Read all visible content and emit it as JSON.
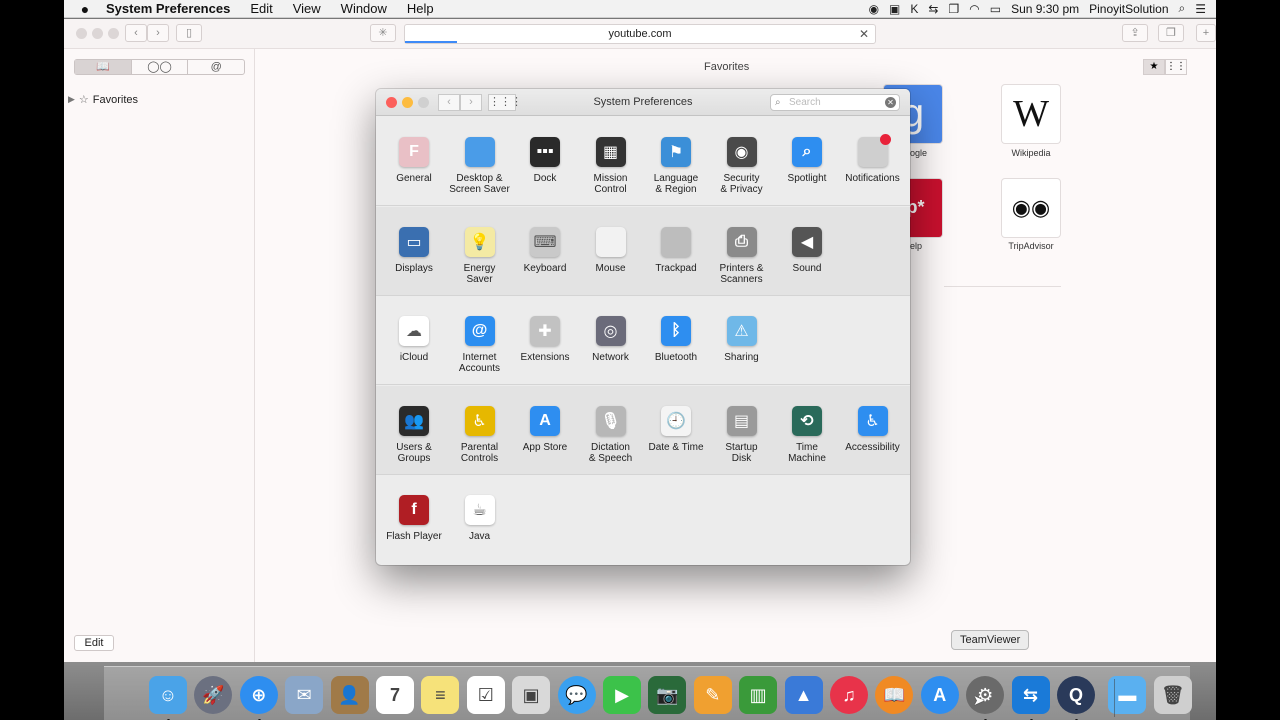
{
  "menubar": {
    "app_name": "System Preferences",
    "menus": [
      "Edit",
      "View",
      "Window",
      "Help"
    ],
    "clock": "Sun 9:30 pm",
    "user": "PinoyitSolution"
  },
  "safari": {
    "url": "youtube.com",
    "load_progress": 0.11,
    "sidebar_section": "Favorites",
    "edit_label": "Edit",
    "content_title": "Favorites",
    "favorites": [
      {
        "label": "oogle",
        "tile_text": "g",
        "color": "#4a86e8"
      },
      {
        "label": "Wikipedia",
        "tile_text": "W",
        "color": "#ffffff"
      },
      {
        "label": "elp",
        "tile_text": "ip*",
        "color": "#c8102e"
      },
      {
        "label": "TripAdvisor",
        "tile_text": "◉◉",
        "color": "#ffffff"
      }
    ]
  },
  "syspref": {
    "title": "System Preferences",
    "search_placeholder": "Search",
    "rows": [
      [
        {
          "label": "General",
          "icon": "general-icon",
          "color": "#e9c0c6",
          "glyph": "F"
        },
        {
          "label": "Desktop &\nScreen Saver",
          "icon": "desktop-icon",
          "color": "#4a9ce8",
          "glyph": ""
        },
        {
          "label": "Dock",
          "icon": "dock-icon",
          "color": "#2a2a2a",
          "glyph": "▪▪▪"
        },
        {
          "label": "Mission\nControl",
          "icon": "mission-control-icon",
          "color": "#333333",
          "glyph": "▦"
        },
        {
          "label": "Language\n& Region",
          "icon": "language-flag-icon",
          "color": "#3b8fd8",
          "glyph": "⚑"
        },
        {
          "label": "Security\n& Privacy",
          "icon": "security-icon",
          "color": "#4a4a4a",
          "glyph": "◉"
        },
        {
          "label": "Spotlight",
          "icon": "spotlight-icon",
          "color": "#2e8ef0",
          "glyph": "⌕"
        },
        {
          "label": "Notifications",
          "icon": "notifications-icon",
          "color": "#cfcfcf",
          "glyph": "●"
        }
      ],
      [
        {
          "label": "Displays",
          "icon": "display-icon",
          "color": "#3a6fb0",
          "glyph": "▭"
        },
        {
          "label": "Energy\nSaver",
          "icon": "lightbulb-icon",
          "color": "#f4eaa4",
          "glyph": "💡"
        },
        {
          "label": "Keyboard",
          "icon": "keyboard-icon",
          "color": "#c9c9c9",
          "glyph": "⌨"
        },
        {
          "label": "Mouse",
          "icon": "mouse-icon",
          "color": "#f2f2f2",
          "glyph": ""
        },
        {
          "label": "Trackpad",
          "icon": "trackpad-icon",
          "color": "#bdbdbd",
          "glyph": ""
        },
        {
          "label": "Printers &\nScanners",
          "icon": "printer-icon",
          "color": "#8a8a8a",
          "glyph": "⎙"
        },
        {
          "label": "Sound",
          "icon": "speaker-icon",
          "color": "#555555",
          "glyph": "◀"
        }
      ],
      [
        {
          "label": "iCloud",
          "icon": "icloud-icon",
          "color": "#ffffff",
          "glyph": "☁"
        },
        {
          "label": "Internet\nAccounts",
          "icon": "at-icon",
          "color": "#2c8ef0",
          "glyph": "@"
        },
        {
          "label": "Extensions",
          "icon": "puzzle-icon",
          "color": "#c2c2c2",
          "glyph": "✚"
        },
        {
          "label": "Network",
          "icon": "globe-icon",
          "color": "#6b6b7a",
          "glyph": "◎"
        },
        {
          "label": "Bluetooth",
          "icon": "bluetooth-icon",
          "color": "#2e8ef0",
          "glyph": "ᛒ"
        },
        {
          "label": "Sharing",
          "icon": "sharing-folder-icon",
          "color": "#6fb8e8",
          "glyph": "⚠"
        }
      ],
      [
        {
          "label": "Users &\nGroups",
          "icon": "users-icon",
          "color": "#2a2a2a",
          "glyph": "👥"
        },
        {
          "label": "Parental\nControls",
          "icon": "parental-controls-icon",
          "color": "#e6b800",
          "glyph": "♿"
        },
        {
          "label": "App Store",
          "icon": "app-store-icon",
          "color": "#2e8ef0",
          "glyph": "A"
        },
        {
          "label": "Dictation\n& Speech",
          "icon": "microphone-icon",
          "color": "#b7b7b7",
          "glyph": "🎙"
        },
        {
          "label": "Date & Time",
          "icon": "clock-icon",
          "color": "#f4f4f4",
          "glyph": "🕘"
        },
        {
          "label": "Startup\nDisk",
          "icon": "disk-icon",
          "color": "#9a9a9a",
          "glyph": "▤"
        },
        {
          "label": "Time\nMachine",
          "icon": "time-machine-icon",
          "color": "#2a6a5a",
          "glyph": "⟲"
        },
        {
          "label": "Accessibility",
          "icon": "accessibility-icon",
          "color": "#2e8ef0",
          "glyph": "♿"
        }
      ],
      [
        {
          "label": "Flash Player",
          "icon": "flash-icon",
          "color": "#b01e24",
          "glyph": "f"
        },
        {
          "label": "Java",
          "icon": "java-icon",
          "color": "#ffffff",
          "glyph": "☕"
        }
      ]
    ]
  },
  "tooltip": "TeamViewer",
  "dock": [
    {
      "name": "finder-icon",
      "color": "#4aa3e8",
      "glyph": "☺",
      "running": true
    },
    {
      "name": "launchpad-icon",
      "color": "#6b7080",
      "glyph": "🚀",
      "running": false
    },
    {
      "name": "safari-icon",
      "color": "#2e8ef0",
      "glyph": "⊕",
      "running": true
    },
    {
      "name": "mail-icon",
      "color": "#8aa6c8",
      "glyph": "✉",
      "running": false
    },
    {
      "name": "contacts-icon",
      "color": "#a07a48",
      "glyph": "👤",
      "running": false
    },
    {
      "name": "calendar-icon",
      "color": "#ffffff",
      "glyph": "7",
      "running": false
    },
    {
      "name": "notes-icon",
      "color": "#f6e27a",
      "glyph": "≡",
      "running": false
    },
    {
      "name": "reminders-icon",
      "color": "#ffffff",
      "glyph": "☑",
      "running": false
    },
    {
      "name": "preview-icon",
      "color": "#d9d9d9",
      "glyph": "▣",
      "running": false
    },
    {
      "name": "messages-icon",
      "color": "#3aa0f0",
      "glyph": "💬",
      "running": false
    },
    {
      "name": "facetime-icon",
      "color": "#3cc24a",
      "glyph": "▶",
      "running": false
    },
    {
      "name": "photo-booth-icon",
      "color": "#2a6a3a",
      "glyph": "📷",
      "running": false
    },
    {
      "name": "pages-icon",
      "color": "#f0a030",
      "glyph": "✎",
      "running": false
    },
    {
      "name": "numbers-icon",
      "color": "#3a9a3a",
      "glyph": "▥",
      "running": false
    },
    {
      "name": "keynote-icon",
      "color": "#3a7ad8",
      "glyph": "▲",
      "running": false
    },
    {
      "name": "itunes-icon",
      "color": "#e8334a",
      "glyph": "♫",
      "running": false
    },
    {
      "name": "ibooks-icon",
      "color": "#f08a24",
      "glyph": "📖",
      "running": false
    },
    {
      "name": "app-store-dock-icon",
      "color": "#2e8ef0",
      "glyph": "A",
      "running": false
    },
    {
      "name": "system-preferences-dock-icon",
      "color": "#6a6a6a",
      "glyph": "⚙",
      "running": true
    },
    {
      "name": "teamviewer-icon",
      "color": "#1a7ad8",
      "glyph": "⇆",
      "running": true
    },
    {
      "name": "quicktime-icon",
      "color": "#2a3a5a",
      "glyph": "Q",
      "running": true
    },
    {
      "name": "downloads-folder-icon",
      "color": "#5ab0f0",
      "glyph": "▬",
      "running": false
    },
    {
      "name": "trash-icon",
      "color": "#cfcfcf",
      "glyph": "🗑",
      "running": false
    }
  ]
}
